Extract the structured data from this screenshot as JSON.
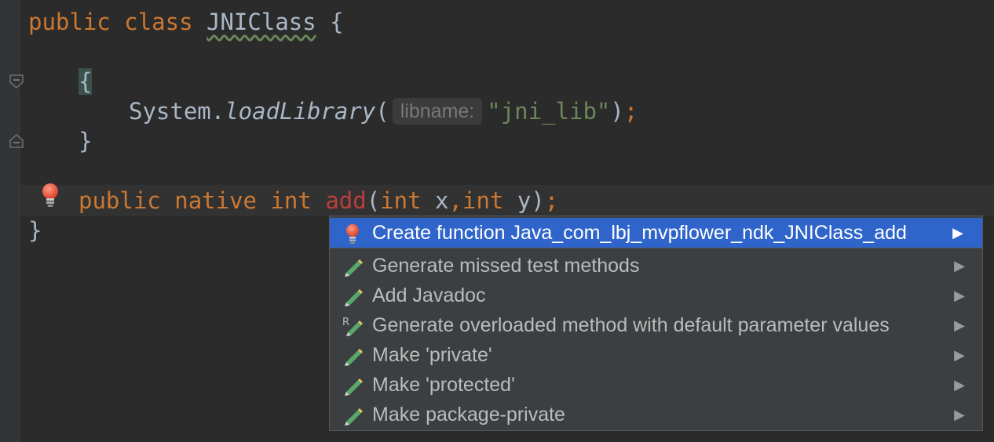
{
  "editor": {
    "line1": {
      "kw_public": "public",
      "kw_class": "class",
      "class_name": "JNIClass",
      "brace": "{"
    },
    "line2": {
      "brace": "{"
    },
    "line3": {
      "obj": "System.",
      "method": "loadLibrary",
      "open_paren": "(",
      "param_hint": "libname:",
      "arg": "\"jni_lib\"",
      "close_paren": ")",
      "semicolon": ";"
    },
    "line4": {
      "brace": "}"
    },
    "line5": {
      "kw_public": "public",
      "kw_native": "native",
      "kw_int": "int",
      "method": "add",
      "open_paren": "(",
      "kw_int2": "int",
      "param_x": "x",
      "comma": ",",
      "kw_int3": "int",
      "param_y": "y",
      "close_paren": ")",
      "semicolon": ";"
    },
    "line6": {
      "brace": "}"
    }
  },
  "gutter_icons": [
    "fold-open-icon",
    "fold-close-icon",
    "lightbulb-error-icon"
  ],
  "intention_popup": {
    "items": [
      {
        "label": "Create function Java_com_lbj_mvpflower_ndk_JNIClass_add",
        "icon": "lightbulb-error-icon",
        "selected": true
      },
      {
        "label": "Generate missed test methods",
        "icon": "pencil-icon",
        "selected": false
      },
      {
        "label": "Add Javadoc",
        "icon": "pencil-icon",
        "selected": false
      },
      {
        "label": "Generate overloaded method with default parameter values",
        "icon": "pencil-r-icon",
        "selected": false
      },
      {
        "label": "Make 'private'",
        "icon": "pencil-icon",
        "selected": false
      },
      {
        "label": "Make 'protected'",
        "icon": "pencil-icon",
        "selected": false
      },
      {
        "label": "Make package-private",
        "icon": "pencil-icon",
        "selected": false
      }
    ],
    "submenu_arrow": "▶"
  },
  "colors": {
    "background": "#2b2b2b",
    "keyword": "#cc7832",
    "string": "#6a8759",
    "error": "#bc3f3c",
    "selection": "#2f65ca",
    "popup_bg": "#3c3f41"
  }
}
